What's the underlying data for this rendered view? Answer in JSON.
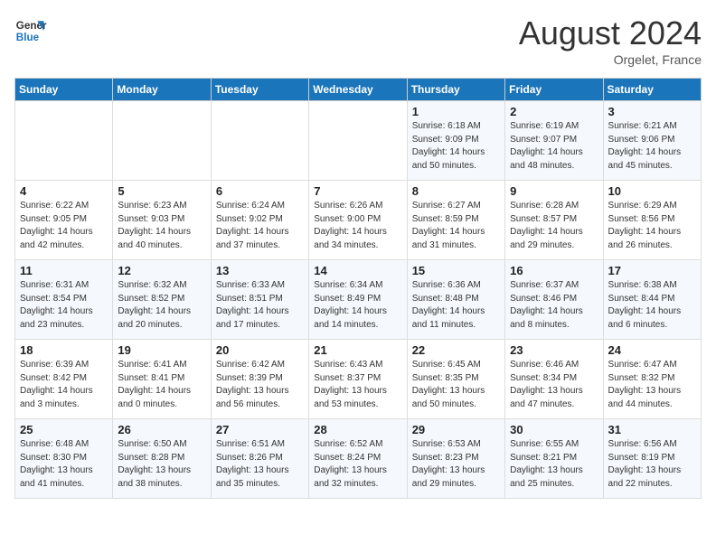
{
  "header": {
    "logo_line1": "General",
    "logo_line2": "Blue",
    "month_title": "August 2024",
    "location": "Orgelet, France"
  },
  "days_of_week": [
    "Sunday",
    "Monday",
    "Tuesday",
    "Wednesday",
    "Thursday",
    "Friday",
    "Saturday"
  ],
  "weeks": [
    [
      {
        "day": "",
        "info": ""
      },
      {
        "day": "",
        "info": ""
      },
      {
        "day": "",
        "info": ""
      },
      {
        "day": "",
        "info": ""
      },
      {
        "day": "1",
        "info": "Sunrise: 6:18 AM\nSunset: 9:09 PM\nDaylight: 14 hours\nand 50 minutes."
      },
      {
        "day": "2",
        "info": "Sunrise: 6:19 AM\nSunset: 9:07 PM\nDaylight: 14 hours\nand 48 minutes."
      },
      {
        "day": "3",
        "info": "Sunrise: 6:21 AM\nSunset: 9:06 PM\nDaylight: 14 hours\nand 45 minutes."
      }
    ],
    [
      {
        "day": "4",
        "info": "Sunrise: 6:22 AM\nSunset: 9:05 PM\nDaylight: 14 hours\nand 42 minutes."
      },
      {
        "day": "5",
        "info": "Sunrise: 6:23 AM\nSunset: 9:03 PM\nDaylight: 14 hours\nand 40 minutes."
      },
      {
        "day": "6",
        "info": "Sunrise: 6:24 AM\nSunset: 9:02 PM\nDaylight: 14 hours\nand 37 minutes."
      },
      {
        "day": "7",
        "info": "Sunrise: 6:26 AM\nSunset: 9:00 PM\nDaylight: 14 hours\nand 34 minutes."
      },
      {
        "day": "8",
        "info": "Sunrise: 6:27 AM\nSunset: 8:59 PM\nDaylight: 14 hours\nand 31 minutes."
      },
      {
        "day": "9",
        "info": "Sunrise: 6:28 AM\nSunset: 8:57 PM\nDaylight: 14 hours\nand 29 minutes."
      },
      {
        "day": "10",
        "info": "Sunrise: 6:29 AM\nSunset: 8:56 PM\nDaylight: 14 hours\nand 26 minutes."
      }
    ],
    [
      {
        "day": "11",
        "info": "Sunrise: 6:31 AM\nSunset: 8:54 PM\nDaylight: 14 hours\nand 23 minutes."
      },
      {
        "day": "12",
        "info": "Sunrise: 6:32 AM\nSunset: 8:52 PM\nDaylight: 14 hours\nand 20 minutes."
      },
      {
        "day": "13",
        "info": "Sunrise: 6:33 AM\nSunset: 8:51 PM\nDaylight: 14 hours\nand 17 minutes."
      },
      {
        "day": "14",
        "info": "Sunrise: 6:34 AM\nSunset: 8:49 PM\nDaylight: 14 hours\nand 14 minutes."
      },
      {
        "day": "15",
        "info": "Sunrise: 6:36 AM\nSunset: 8:48 PM\nDaylight: 14 hours\nand 11 minutes."
      },
      {
        "day": "16",
        "info": "Sunrise: 6:37 AM\nSunset: 8:46 PM\nDaylight: 14 hours\nand 8 minutes."
      },
      {
        "day": "17",
        "info": "Sunrise: 6:38 AM\nSunset: 8:44 PM\nDaylight: 14 hours\nand 6 minutes."
      }
    ],
    [
      {
        "day": "18",
        "info": "Sunrise: 6:39 AM\nSunset: 8:42 PM\nDaylight: 14 hours\nand 3 minutes."
      },
      {
        "day": "19",
        "info": "Sunrise: 6:41 AM\nSunset: 8:41 PM\nDaylight: 14 hours\nand 0 minutes."
      },
      {
        "day": "20",
        "info": "Sunrise: 6:42 AM\nSunset: 8:39 PM\nDaylight: 13 hours\nand 56 minutes."
      },
      {
        "day": "21",
        "info": "Sunrise: 6:43 AM\nSunset: 8:37 PM\nDaylight: 13 hours\nand 53 minutes."
      },
      {
        "day": "22",
        "info": "Sunrise: 6:45 AM\nSunset: 8:35 PM\nDaylight: 13 hours\nand 50 minutes."
      },
      {
        "day": "23",
        "info": "Sunrise: 6:46 AM\nSunset: 8:34 PM\nDaylight: 13 hours\nand 47 minutes."
      },
      {
        "day": "24",
        "info": "Sunrise: 6:47 AM\nSunset: 8:32 PM\nDaylight: 13 hours\nand 44 minutes."
      }
    ],
    [
      {
        "day": "25",
        "info": "Sunrise: 6:48 AM\nSunset: 8:30 PM\nDaylight: 13 hours\nand 41 minutes."
      },
      {
        "day": "26",
        "info": "Sunrise: 6:50 AM\nSunset: 8:28 PM\nDaylight: 13 hours\nand 38 minutes."
      },
      {
        "day": "27",
        "info": "Sunrise: 6:51 AM\nSunset: 8:26 PM\nDaylight: 13 hours\nand 35 minutes."
      },
      {
        "day": "28",
        "info": "Sunrise: 6:52 AM\nSunset: 8:24 PM\nDaylight: 13 hours\nand 32 minutes."
      },
      {
        "day": "29",
        "info": "Sunrise: 6:53 AM\nSunset: 8:23 PM\nDaylight: 13 hours\nand 29 minutes."
      },
      {
        "day": "30",
        "info": "Sunrise: 6:55 AM\nSunset: 8:21 PM\nDaylight: 13 hours\nand 25 minutes."
      },
      {
        "day": "31",
        "info": "Sunrise: 6:56 AM\nSunset: 8:19 PM\nDaylight: 13 hours\nand 22 minutes."
      }
    ]
  ]
}
